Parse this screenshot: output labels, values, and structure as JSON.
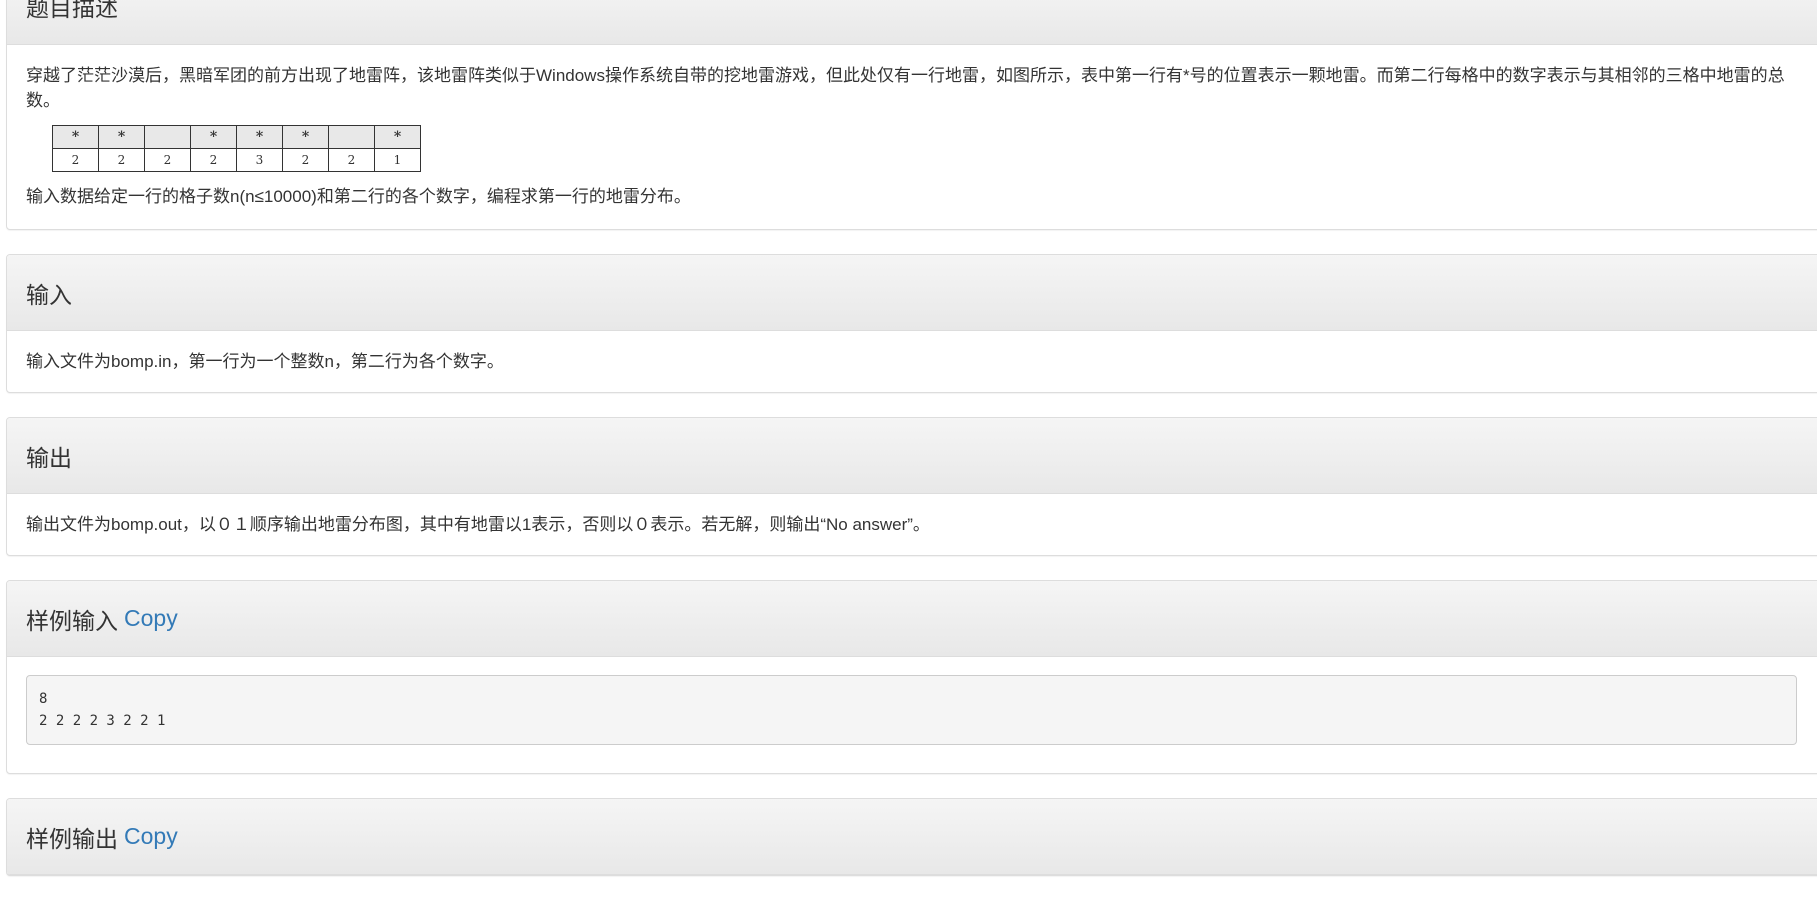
{
  "description": {
    "title": "题目描述",
    "paragraph1": "穿越了茫茫沙漠后，黑暗军团的前方出现了地雷阵，该地雷阵类似于Windows操作系统自带的挖地雷游戏，但此处仅有一行地雷，如图所示，表中第一行有*号的位置表示一颗地雷。而第二行每格中的数字表示与其相邻的三格中地雷的总数。",
    "mines_row": [
      "*",
      "*",
      "",
      "*",
      "*",
      "*",
      "",
      "*"
    ],
    "counts_row": [
      "2",
      "2",
      "2",
      "2",
      "3",
      "2",
      "2",
      "1"
    ],
    "paragraph2": "输入数据给定一行的格子数n(n≤10000)和第二行的各个数字，编程求第一行的地雷分布。"
  },
  "input": {
    "title": "输入",
    "text": "输入文件为bomp.in，第一行为一个整数n，第二行为各个数字。"
  },
  "output": {
    "title": "输出",
    "text": "输出文件为bomp.out，以０１顺序输出地雷分布图，其中有地雷以1表示，否则以０表示。若无解，则输出“No answer”。"
  },
  "sample_input": {
    "title": "样例输入",
    "copy_label": "Copy",
    "content": "8\n2 2 2 2 3 2 2 1"
  },
  "sample_output": {
    "title": "样例输出",
    "copy_label": "Copy"
  },
  "colors": {
    "link": "#337ab7",
    "heading_bg": "#f0f0f0",
    "pre_bg": "#f5f5f5"
  }
}
